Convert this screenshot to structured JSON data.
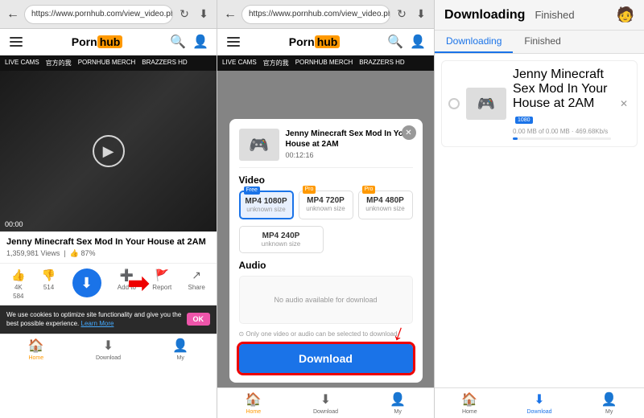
{
  "panel1": {
    "browser_url": "https://www.pornhub.com/view_video.php?vi...",
    "site_name_black": "Porn",
    "site_name_orange": "hub",
    "nav_items": [
      "LIVE CAMS",
      "官方的我",
      "PORNHUB MERCH",
      "BRAZZERS HD"
    ],
    "video_time": "00:00",
    "video_title": "Jenny Minecraft Sex Mod In Your House at 2AM",
    "video_views": "1,359,981 Views",
    "video_likes": "87%",
    "actions": [
      {
        "label": "4K",
        "count": "584"
      },
      {
        "label": "",
        "count": "514"
      },
      {
        "label": "Add to"
      },
      {
        "label": "Report"
      },
      {
        "label": "Share"
      }
    ],
    "cookie_text": "We use cookies to optimize site functionality and give you the best possible experience.",
    "cookie_link": "Learn More",
    "cookie_ok": "OK",
    "bottom_nav": [
      {
        "label": "Home",
        "active": true
      },
      {
        "label": "Download"
      },
      {
        "label": "My"
      }
    ]
  },
  "panel2": {
    "browser_url": "https://www.pornhub.com/view_video.php?vi...",
    "site_name_black": "Porn",
    "site_name_orange": "hub",
    "nav_items": [
      "LIVE CAMS",
      "官方的我",
      "PORNHUB MERCH",
      "BRAZZERS HD"
    ],
    "modal": {
      "title": "Jenny Minecraft Sex Mod In Your House at 2AM",
      "duration": "00:12:16",
      "section_video": "Video",
      "quality_options": [
        {
          "label": "MP4 1080P",
          "size": "unknown size",
          "badge": "Free",
          "selected": true
        },
        {
          "label": "MP4 720P",
          "size": "unknown size",
          "badge": "Pro"
        },
        {
          "label": "MP4 480P",
          "size": "unknown size",
          "badge": "Pro"
        },
        {
          "label": "MP4 240P",
          "size": "unknown size"
        }
      ],
      "section_audio": "Audio",
      "no_audio_text": "No audio available for download",
      "note": "⊙ Only one video or audio can be selected to download",
      "download_btn": "Download"
    },
    "bottom_nav": [
      {
        "label": "Home",
        "active": true
      },
      {
        "label": "Download"
      },
      {
        "label": "My"
      }
    ]
  },
  "panel3": {
    "title": "Downloading",
    "status": "Finished",
    "tabs": [
      {
        "label": "Downloading",
        "active": true
      },
      {
        "label": "Finished"
      }
    ],
    "downloads": [
      {
        "title": "Jenny Minecraft Sex Mod In Your House at 2AM",
        "badge": "1080",
        "progress_text": "0.00 MB of 0.00 MB · 469.68Kb/s",
        "progress_pct": "5%"
      }
    ],
    "bottom_nav": [
      {
        "label": "Home"
      },
      {
        "label": "Download",
        "active": true
      },
      {
        "label": "My"
      }
    ]
  }
}
